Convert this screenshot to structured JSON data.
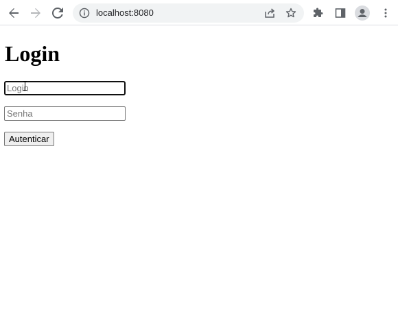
{
  "browser": {
    "url": "localhost:8080",
    "icons": {
      "back": "arrow-left-icon",
      "forward": "arrow-right-icon",
      "reload": "reload-icon",
      "info": "info-icon",
      "share": "share-icon",
      "bookmark": "star-icon",
      "extensions": "puzzle-icon",
      "side_panel": "side-panel-icon",
      "profile": "avatar-icon",
      "menu": "kebab-menu-icon"
    }
  },
  "page": {
    "title": "Login",
    "login_placeholder": "Login",
    "password_placeholder": "Senha",
    "submit_label": "Autenticar"
  }
}
